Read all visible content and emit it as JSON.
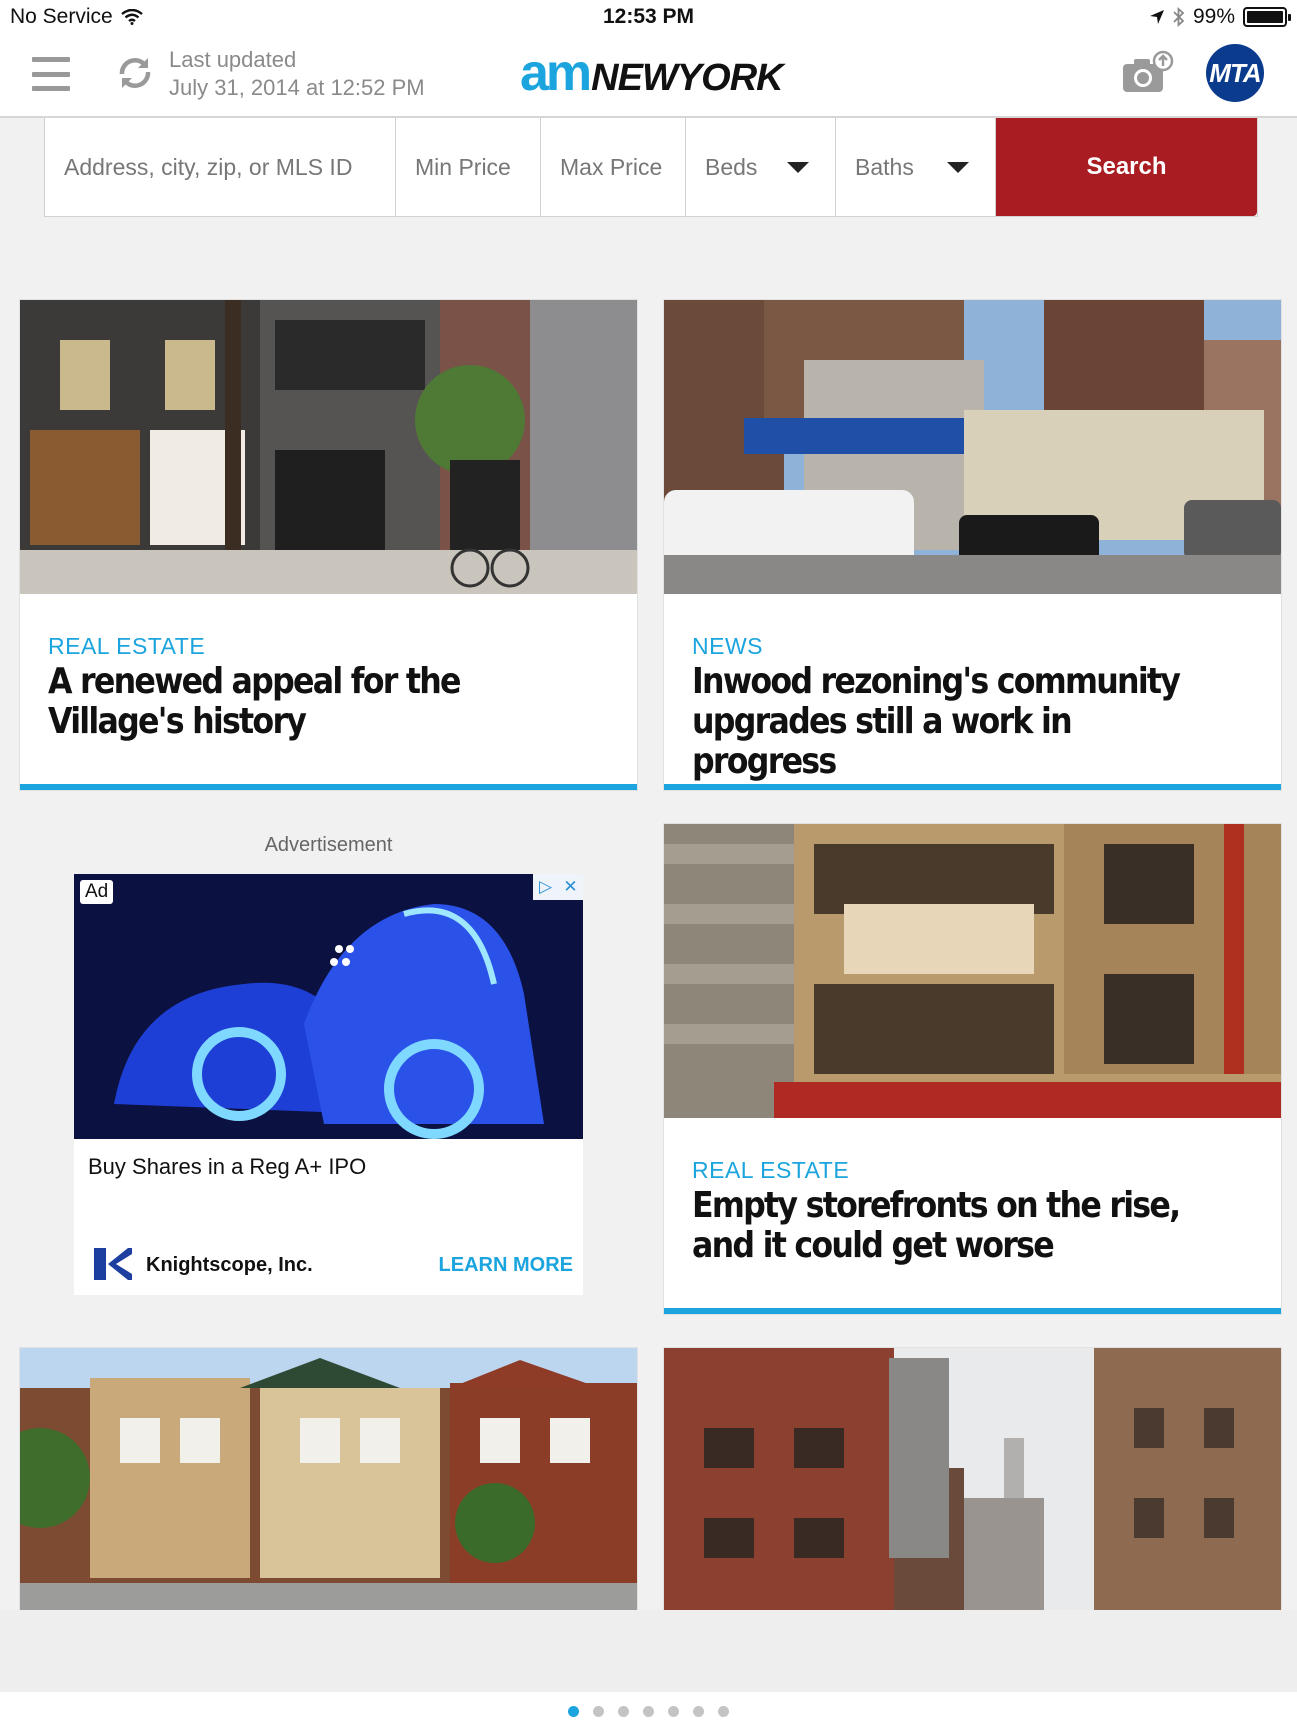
{
  "status_bar": {
    "carrier": "No Service",
    "time": "12:53 PM",
    "battery": "99%"
  },
  "nav": {
    "updated_label": "Last updated",
    "updated_time": "July 31, 2014 at 12:52 PM",
    "logo_am": "am",
    "logo_newyork": "NEWYORK",
    "mta_label": "MTA"
  },
  "search": {
    "address_placeholder": "Address, city, zip, or MLS ID",
    "min_price": "Min Price",
    "max_price": "Max Price",
    "beds": "Beds",
    "baths": "Baths",
    "button": "Search"
  },
  "articles": [
    {
      "category": "REAL ESTATE",
      "title": "A renewed appeal for the Village's history"
    },
    {
      "category": "NEWS",
      "title": "Inwood rezoning's community upgrades still a work in progress"
    },
    {
      "category": "REAL ESTATE",
      "title": "Empty storefronts on the rise, and it could get worse"
    }
  ],
  "ad": {
    "label": "Advertisement",
    "badge": "Ad",
    "headline": "Buy Shares in a Reg A+ IPO",
    "advertiser": "Knightscope, Inc.",
    "cta": "LEARN MORE"
  },
  "pager": {
    "total": 7,
    "active": 1
  },
  "colors": {
    "accent": "#1ba4dd",
    "search_button": "#a81c22",
    "mta": "#0b3b8c"
  }
}
